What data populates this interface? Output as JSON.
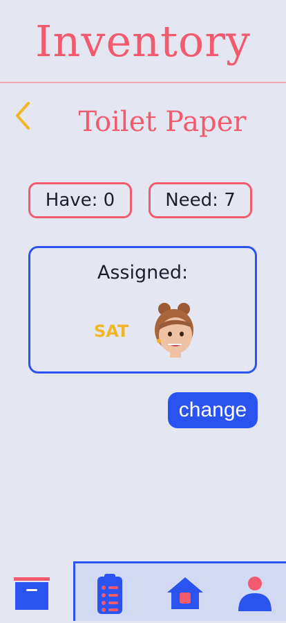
{
  "header": {
    "title": "Inventory"
  },
  "item": {
    "name": "Toilet Paper",
    "back_icon": "chevron-left-icon"
  },
  "counts": {
    "have_label": "Have: 0",
    "need_label": "Need: 7"
  },
  "assignment": {
    "label": "Assigned:",
    "day": "SAT",
    "avatar_icon": "memoji-avatar"
  },
  "actions": {
    "change_label": "change"
  },
  "tabs": [
    {
      "icon": "inventory-box-icon",
      "active": true
    },
    {
      "icon": "checklist-icon",
      "active": false
    },
    {
      "icon": "home-icon",
      "active": false
    },
    {
      "icon": "profile-icon",
      "active": false
    }
  ],
  "colors": {
    "background": "#e4e7f2",
    "accent_pink": "#f25a6e",
    "accent_blue": "#2b53f0",
    "accent_yellow": "#f2b523",
    "tab_group_bg": "#d2d9f3"
  }
}
